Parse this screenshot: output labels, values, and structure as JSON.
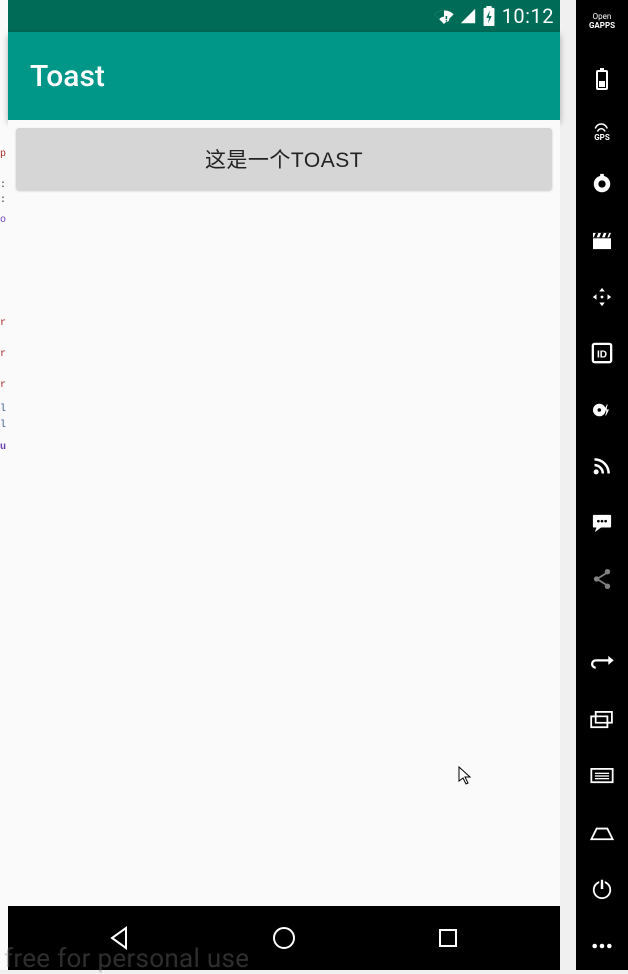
{
  "status_bar": {
    "time": "10:12"
  },
  "app_bar": {
    "title": "Toast"
  },
  "content": {
    "button_label": "这是一个TOAST"
  },
  "side_toolbar": {
    "open_gapps_l1": "Open",
    "open_gapps_l2": "GAPPS",
    "gps_label": "GPS"
  },
  "watermark": "free for personal use"
}
